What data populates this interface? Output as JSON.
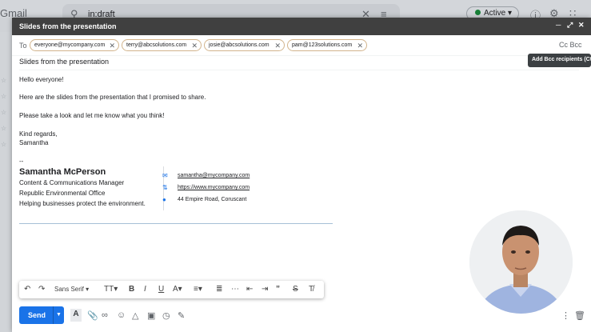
{
  "background": {
    "logo": "Gmail",
    "search_text": "in:draft",
    "status_label": "Active"
  },
  "compose": {
    "title": "Slides from the presentation",
    "to_label": "To",
    "recipients": [
      "everyone@mycompany.com",
      "terry@abcsolutions.com",
      "josie@abcsolutions.com",
      "pam@123solutions.com"
    ],
    "cc_label": "Cc",
    "bcc_label": "Bcc",
    "tooltip": "Add Bcc recipients (Ct",
    "subject": "Slides from the presentation",
    "body": [
      "Hello everyone!",
      "Here are the slides from the presentation that I promised to share.",
      "Please take a look and let me know what you think!",
      "Kind regards,",
      "Samantha"
    ],
    "signature_separator": "--",
    "signature": {
      "name": "Samantha McPerson",
      "title": "Content & Communications Manager",
      "office": "Republic Environmental Office",
      "tagline": "Helping businesses protect the environment.",
      "email": "samantha@mycompany.com",
      "website": "https://www.mycompany.com",
      "address": "44 Empire Road, Coruscant"
    },
    "toolbar": {
      "font": "Sans Serif"
    },
    "send_label": "Send"
  },
  "colors": {
    "send": "#1a73e8",
    "titlebar": "#404040",
    "chip_border": "#d2b48c"
  }
}
